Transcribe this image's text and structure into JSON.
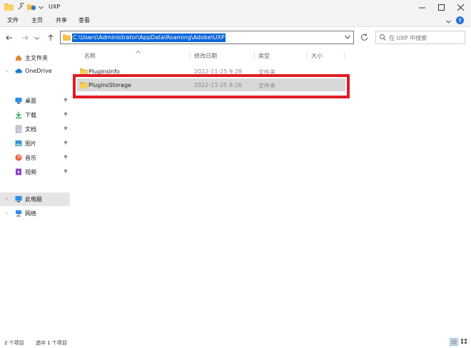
{
  "window": {
    "title": "UXP"
  },
  "ribbon": {
    "tabs": [
      "文件",
      "主页",
      "共享",
      "查看"
    ]
  },
  "address_bar": {
    "path": "C:\\Users\\Administrator\\AppData\\Roaming\\Adobe\\UXP"
  },
  "search": {
    "placeholder": "在 UXP 中搜索"
  },
  "sidebar": {
    "quick_access": "主文件夹",
    "onedrive": "OneDrive",
    "pinned": [
      {
        "label": "桌面",
        "icon": "desktop-icon"
      },
      {
        "label": "下载",
        "icon": "download-icon"
      },
      {
        "label": "文档",
        "icon": "document-icon"
      },
      {
        "label": "图片",
        "icon": "picture-icon"
      },
      {
        "label": "音乐",
        "icon": "music-icon"
      },
      {
        "label": "视频",
        "icon": "video-icon"
      }
    ],
    "this_pc": "此电脑",
    "network": "网络"
  },
  "columns": {
    "name": "名称",
    "modified": "修改日期",
    "type": "类型",
    "size": "大小"
  },
  "files": [
    {
      "name": "PluginsInfo",
      "modified": "2022-11-25 9:28",
      "type": "文件夹"
    },
    {
      "name": "PluginsStorage",
      "modified": "2022-11-25 8:26",
      "type": "文件夹"
    }
  ],
  "status": {
    "item_count": "2 个项目",
    "selection": "选中 1 个项目"
  },
  "colors": {
    "accent": "#0a64d8",
    "highlight_border": "#e01c24",
    "folder": "#f2c14e"
  }
}
